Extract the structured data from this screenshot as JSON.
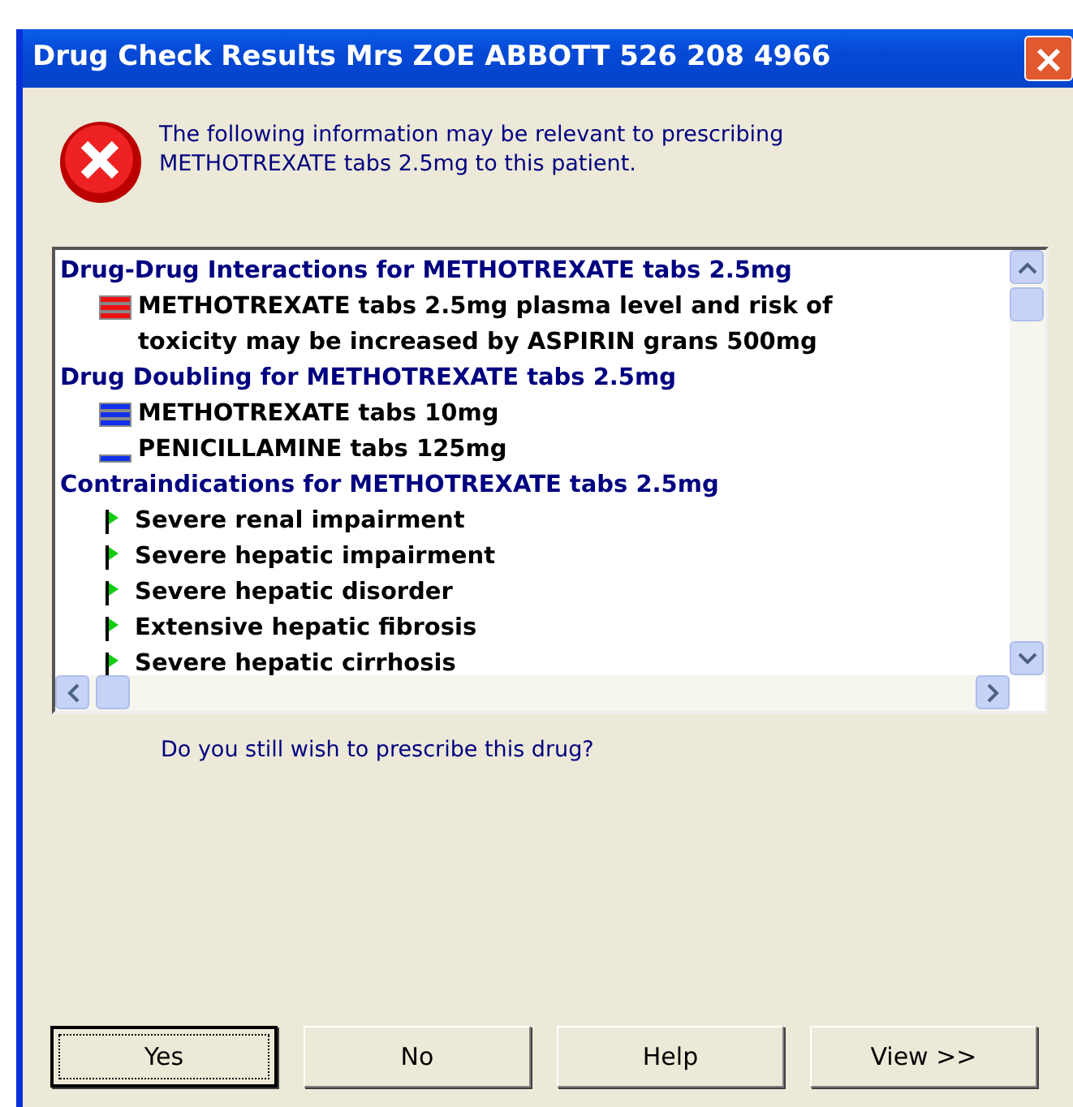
{
  "window": {
    "title": "Drug Check Results Mrs ZOE ABBOTT 526 208 4966"
  },
  "message": "The following information may be relevant to prescribing METHOTREXATE tabs 2.5mg to this patient.",
  "results": [
    {
      "heading": "Drug-Drug Interactions for METHOTREXATE tabs 2.5mg",
      "items": [
        {
          "kind": "interaction",
          "text": "METHOTREXATE tabs 2.5mg plasma level and risk of toxicity may be increased by ASPIRIN grans 500mg"
        }
      ]
    },
    {
      "heading": "Drug Doubling for METHOTREXATE tabs 2.5mg",
      "items": [
        {
          "kind": "doubling",
          "text": "METHOTREXATE tabs 10mg"
        },
        {
          "kind": "doubling-minor",
          "text": "PENICILLAMINE tabs 125mg"
        }
      ]
    },
    {
      "heading": "Contraindications for METHOTREXATE tabs 2.5mg",
      "items": [
        {
          "kind": "contraindication",
          "text": "Severe renal impairment"
        },
        {
          "kind": "contraindication",
          "text": "Severe hepatic impairment"
        },
        {
          "kind": "contraindication",
          "text": "Severe hepatic disorder"
        },
        {
          "kind": "contraindication",
          "text": "Extensive hepatic fibrosis"
        },
        {
          "kind": "contraindication",
          "text": "Severe hepatic cirrhosis"
        }
      ]
    }
  ],
  "question": "Do you still wish to prescribe this drug?",
  "buttons": [
    {
      "label": "Yes",
      "default": true
    },
    {
      "label": "No",
      "default": false
    },
    {
      "label": "Help",
      "default": false
    },
    {
      "label": "View >>",
      "default": false
    }
  ]
}
